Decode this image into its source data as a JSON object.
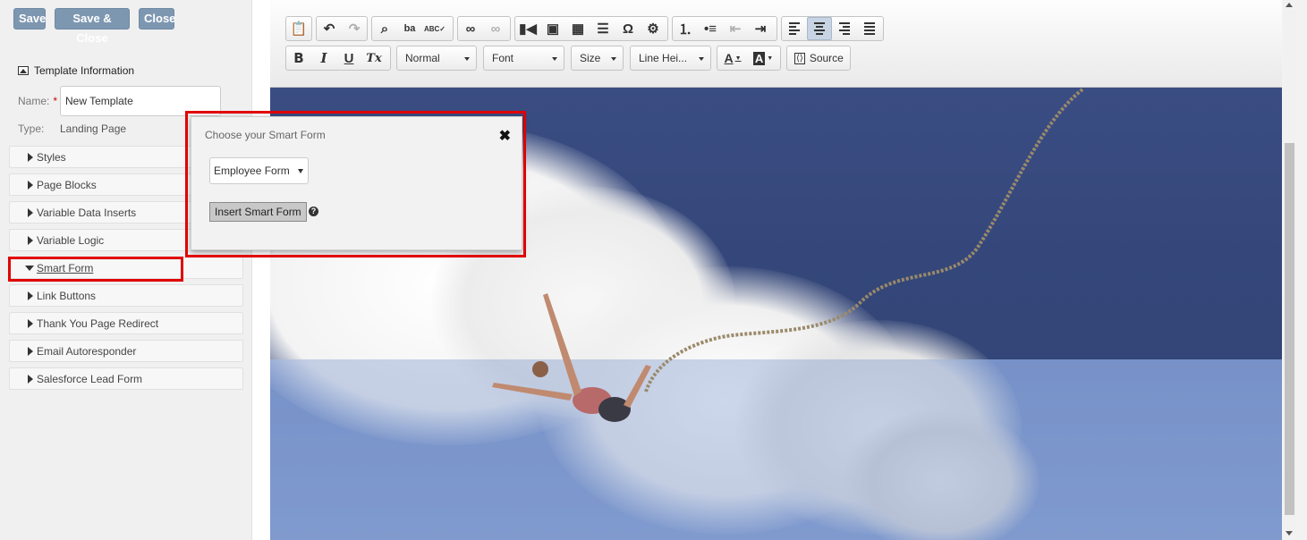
{
  "actions": {
    "save": "Save",
    "save_close": "Save & Close",
    "close": "Close"
  },
  "template_info": {
    "title": "Template Information",
    "name_label": "Name:",
    "required_mark": "*",
    "name_value": "New Template",
    "type_label": "Type:",
    "type_value": "Landing Page"
  },
  "sections": [
    {
      "label": "Styles",
      "expanded": false
    },
    {
      "label": "Page Blocks",
      "expanded": false
    },
    {
      "label": "Variable Data Inserts",
      "expanded": false
    },
    {
      "label": "Variable Logic",
      "expanded": false
    },
    {
      "label": "Smart Form",
      "expanded": true
    },
    {
      "label": "Link Buttons",
      "expanded": false
    },
    {
      "label": "Thank You Page Redirect",
      "expanded": false
    },
    {
      "label": "Email Autoresponder",
      "expanded": false
    },
    {
      "label": "Salesforce Lead Form",
      "expanded": false
    }
  ],
  "toolbar": {
    "format": "Normal",
    "font": "Font",
    "size": "Size",
    "line_height": "Line Hei...",
    "source": "Source",
    "bold": "B",
    "italic": "I",
    "underline": "U",
    "remove_format": "Tx",
    "text_color": "A",
    "bg_color": "A",
    "special_char": "Ω"
  },
  "dialog": {
    "title": "Choose your Smart Form",
    "close": "✖",
    "selected_form": "Employee Form",
    "insert_button": "Insert Smart Form",
    "help": "?"
  },
  "colors": {
    "highlight": "#e00000",
    "button_blue": "#7d97b1",
    "sky_dark": "#3a4d83",
    "sky_light": "#8aa2d2"
  }
}
